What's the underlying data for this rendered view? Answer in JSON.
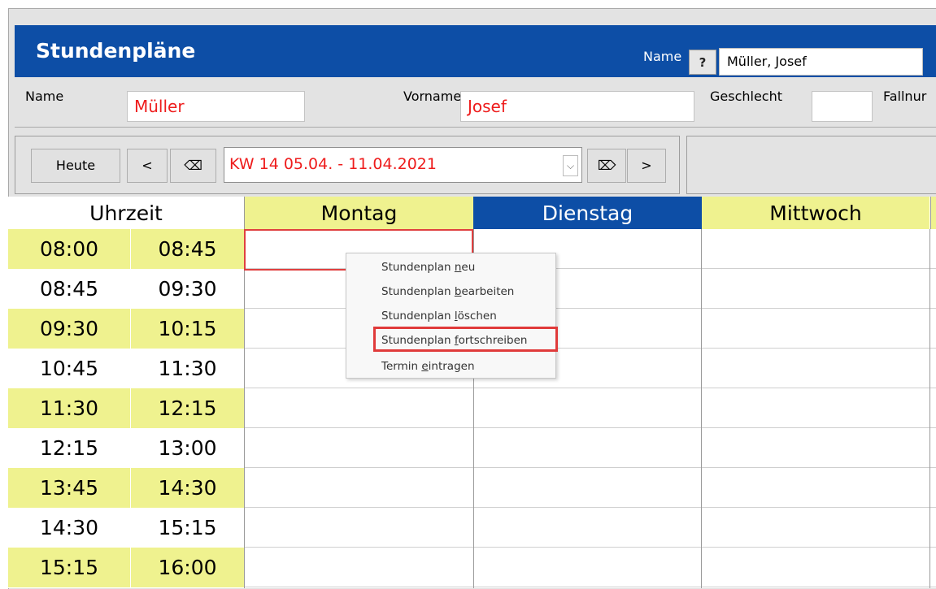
{
  "header": {
    "title": "Stundenpläne",
    "name_label": "Name",
    "help_button": "?",
    "name_value": "Müller, Josef"
  },
  "person": {
    "name_label": "Name",
    "name_value": "Müller",
    "firstname_label": "Vorname",
    "firstname_value": "Josef",
    "gender_label": "Geschlecht",
    "gender_value": "",
    "case_label": "Fallnur"
  },
  "nav": {
    "today": "Heute",
    "prev": "<",
    "clear_left": "⌫",
    "week": "KW 14 05.04. - 11.04.2021",
    "clear_right": "⌦",
    "next": ">"
  },
  "grid": {
    "time_header": "Uhrzeit",
    "days": [
      "Montag",
      "Dienstag",
      "Mittwoch"
    ],
    "slots": [
      {
        "from": "08:00",
        "to": "08:45"
      },
      {
        "from": "08:45",
        "to": "09:30"
      },
      {
        "from": "09:30",
        "to": "10:15"
      },
      {
        "from": "10:45",
        "to": "11:30"
      },
      {
        "from": "11:30",
        "to": "12:15"
      },
      {
        "from": "12:15",
        "to": "13:00"
      },
      {
        "from": "13:45",
        "to": "14:30"
      },
      {
        "from": "14:30",
        "to": "15:15"
      },
      {
        "from": "15:15",
        "to": "16:00"
      }
    ]
  },
  "context_menu": {
    "items": [
      {
        "pre": "Stundenplan ",
        "key": "n",
        "post": "eu"
      },
      {
        "pre": "Stundenplan ",
        "key": "b",
        "post": "earbeiten"
      },
      {
        "pre": "Stundenplan ",
        "key": "l",
        "post": "öschen"
      },
      {
        "pre": "Stundenplan ",
        "key": "f",
        "post": "ortschreiben"
      },
      {
        "pre": "Termin ",
        "key": "e",
        "post": "intragen"
      }
    ]
  },
  "colors": {
    "title_bar": "#0d4ea6",
    "highlight_row": "#eff28f",
    "active_day": "#0d4ea6",
    "accent_red": "#ee1c1c"
  }
}
